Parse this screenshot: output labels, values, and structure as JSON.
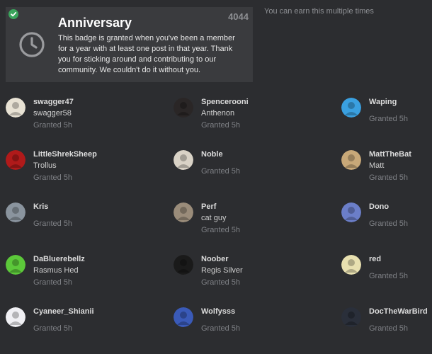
{
  "badge": {
    "title": "Anniversary",
    "grant_count": "4044",
    "description": "This badge is granted when you've been a member for a year with at least one post in that year. Thank you for sticking around and contributing to our community. We couldn't do it without you.",
    "earn_note": "You can earn this multiple times",
    "icon": "clock-icon",
    "check_icon": "check-icon",
    "check_color": "#3aa55c"
  },
  "users": [
    {
      "username": "swagger47",
      "name": "swagger58",
      "granted": "Granted 5h",
      "avatar_color": "#e8e2d4"
    },
    {
      "username": "Spencerooni",
      "name": "Anthenon",
      "granted": "Granted 5h",
      "avatar_color": "#2a2626"
    },
    {
      "username": "Waping",
      "name": "",
      "granted": "Granted 5h",
      "avatar_color": "#3aa0e0"
    },
    {
      "username": "LittleShrekSheep",
      "name": "Trollus",
      "granted": "Granted 5h",
      "avatar_color": "#b01a1a"
    },
    {
      "username": "Noble",
      "name": "",
      "granted": "Granted 5h",
      "avatar_color": "#d9d2c6"
    },
    {
      "username": "MattTheBat",
      "name": "Matt",
      "granted": "Granted 5h",
      "avatar_color": "#c8a878"
    },
    {
      "username": "Kris",
      "name": "",
      "granted": "Granted 5h",
      "avatar_color": "#8a949e"
    },
    {
      "username": "Perf",
      "name": "cat guy",
      "granted": "Granted 5h",
      "avatar_color": "#9a8c7a"
    },
    {
      "username": "Dono",
      "name": "",
      "granted": "Granted 5h",
      "avatar_color": "#6b7ec8"
    },
    {
      "username": "DaBluerebellz",
      "name": "Rasmus Hed",
      "granted": "Granted 5h",
      "avatar_color": "#5cc83a"
    },
    {
      "username": "Noober",
      "name": "Regis Silver",
      "granted": "Granted 5h",
      "avatar_color": "#1a1a1a"
    },
    {
      "username": "red",
      "name": "",
      "granted": "Granted 5h",
      "avatar_color": "#e8e0b0"
    },
    {
      "username": "Cyaneer_Shianii",
      "name": "",
      "granted": "Granted 5h",
      "avatar_color": "#f0f0f4"
    },
    {
      "username": "Wolfysss",
      "name": "",
      "granted": "Granted 5h",
      "avatar_color": "#3a5ab8"
    },
    {
      "username": "DocTheWarBird",
      "name": "",
      "granted": "Granted 5h",
      "avatar_color": "#2a2f3a"
    }
  ]
}
